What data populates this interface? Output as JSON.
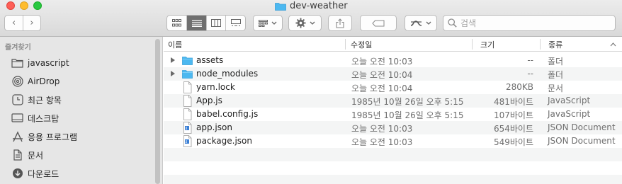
{
  "window": {
    "title": "dev-weather"
  },
  "toolbar": {
    "back_label": "‹",
    "forward_label": "›",
    "search_placeholder": "검색"
  },
  "sidebar": {
    "section_title": "즐겨찾기",
    "items": [
      {
        "label": "javascript",
        "icon": "folder-icon"
      },
      {
        "label": "AirDrop",
        "icon": "airdrop-icon"
      },
      {
        "label": "최근 항목",
        "icon": "recents-icon"
      },
      {
        "label": "데스크탑",
        "icon": "desktop-icon"
      },
      {
        "label": "응용 프로그램",
        "icon": "applications-icon"
      },
      {
        "label": "문서",
        "icon": "document-icon"
      },
      {
        "label": "다운로드",
        "icon": "downloads-icon"
      }
    ]
  },
  "columns": {
    "name": "이름",
    "date": "수정일",
    "size": "크기",
    "kind": "종류"
  },
  "files": [
    {
      "name": "assets",
      "date": "오늘 오전 10:03",
      "size": "--",
      "kind": "폴더",
      "type": "folder"
    },
    {
      "name": "node_modules",
      "date": "오늘 오전 10:04",
      "size": "--",
      "kind": "폴더",
      "type": "folder"
    },
    {
      "name": "yarn.lock",
      "date": "오늘 오전 10:04",
      "size": "280KB",
      "kind": "문서",
      "type": "doc"
    },
    {
      "name": "App.js",
      "date": "1985년 10월 26일 오후 5:15",
      "size": "481바이트",
      "kind": "JavaScript",
      "type": "doc"
    },
    {
      "name": "babel.config.js",
      "date": "1985년 10월 26일 오후 5:15",
      "size": "107바이트",
      "kind": "JavaScript",
      "type": "doc"
    },
    {
      "name": "app.json",
      "date": "오늘 오전 10:03",
      "size": "654바이트",
      "kind": "JSON Document",
      "type": "json"
    },
    {
      "name": "package.json",
      "date": "오늘 오전 10:03",
      "size": "549바이트",
      "kind": "JSON Document",
      "type": "json"
    }
  ],
  "colors": {
    "folder": "#4cb8f0",
    "active_view": "#6f6f6f",
    "sidebar_bg": "#e6e6e6"
  }
}
